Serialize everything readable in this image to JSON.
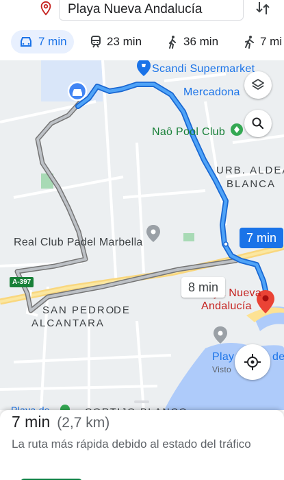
{
  "search": {
    "destination": "Playa Nueva Andalucía",
    "icons": {
      "destination": "location-pin-icon",
      "swap": "swap-vertical-icon"
    }
  },
  "modes": [
    {
      "name": "driving",
      "icon": "car-icon",
      "time": "7 min",
      "selected": true
    },
    {
      "name": "transit",
      "icon": "train-icon",
      "time": "23 min",
      "selected": false
    },
    {
      "name": "walking",
      "icon": "walking-icon",
      "time": "36 min",
      "selected": false
    },
    {
      "name": "ride",
      "icon": "ride-icon",
      "time": "7 mi",
      "selected": false
    }
  ],
  "map": {
    "labels": {
      "supermarket": "Scandi Supermarket",
      "mercadona": "Mercadona",
      "pool_club": "Naô Pool Club",
      "urb_line1": "URB. ALDEA",
      "urb_line2": "BLANCA",
      "padel_club": "Real Club Padel Marbella",
      "san_pedro_line1": "SAN PEDRO",
      "san_pedro_line2": "DE",
      "san_pedro_line3": "ALCANTARA",
      "dest_line1": "Playa Nueva",
      "dest_line2": "Andalucía",
      "playa_partial": "Play",
      "playa_de_partial": "de",
      "visto_partial": "Visto",
      "playa_left_partial": "Playa de",
      "cortijo": "CORTIJO BLANCO"
    },
    "road_shield": "A-397",
    "primary_route_time": "7 min",
    "alternate_route_time": "8 min",
    "colors": {
      "primary_route": "#4285f4",
      "alternate_route": "#9aa0a6",
      "water": "#aecbfa",
      "park": "#a8dab5"
    },
    "controls": {
      "layers": "layers-icon",
      "search": "search-icon",
      "recenter": "my-location-icon"
    }
  },
  "sheet": {
    "duration": "7 min",
    "distance": "(2,7 km)",
    "description": "La ruta más rápida debido al estado del tráfico"
  }
}
